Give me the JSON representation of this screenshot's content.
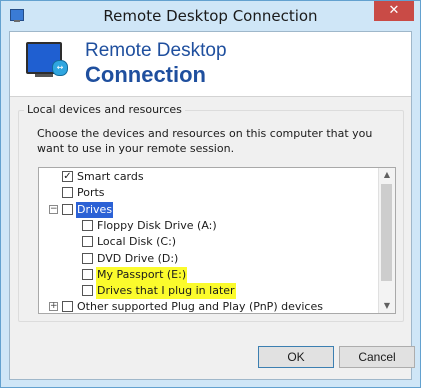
{
  "window": {
    "title": "Remote Desktop Connection",
    "close_glyph": "✕"
  },
  "header": {
    "line1": "Remote Desktop",
    "line2": "Connection",
    "plug_glyph": "↔"
  },
  "group": {
    "label": "Local devices and resources",
    "description": "Choose the devices and resources on this computer that you want to use in your remote session."
  },
  "tree": [
    {
      "label": "Smart cards",
      "checked": true,
      "indent": 0,
      "expander": ""
    },
    {
      "label": "Ports",
      "checked": false,
      "indent": 0,
      "expander": ""
    },
    {
      "label": "Drives",
      "checked": false,
      "indent": 0,
      "expander": "−",
      "selected": true
    },
    {
      "label": "Floppy Disk Drive (A:)",
      "checked": false,
      "indent": 1,
      "expander": ""
    },
    {
      "label": "Local Disk (C:)",
      "checked": false,
      "indent": 1,
      "expander": ""
    },
    {
      "label": "DVD Drive (D:)",
      "checked": false,
      "indent": 1,
      "expander": ""
    },
    {
      "label": "My Passport (E:)",
      "checked": false,
      "indent": 1,
      "expander": "",
      "highlighted": true
    },
    {
      "label": "Drives that I plug in later",
      "checked": false,
      "indent": 1,
      "expander": "",
      "highlighted": true
    },
    {
      "label": "Other supported Plug and Play (PnP) devices",
      "checked": false,
      "indent": 0,
      "expander": "+"
    }
  ],
  "scroll": {
    "up_glyph": "▲",
    "down_glyph": "▼"
  },
  "buttons": {
    "ok": "OK",
    "cancel": "Cancel"
  },
  "colors": {
    "selection": "#2b61d5",
    "highlight": "#fbfb2c",
    "header_text": "#1f4f9e"
  }
}
